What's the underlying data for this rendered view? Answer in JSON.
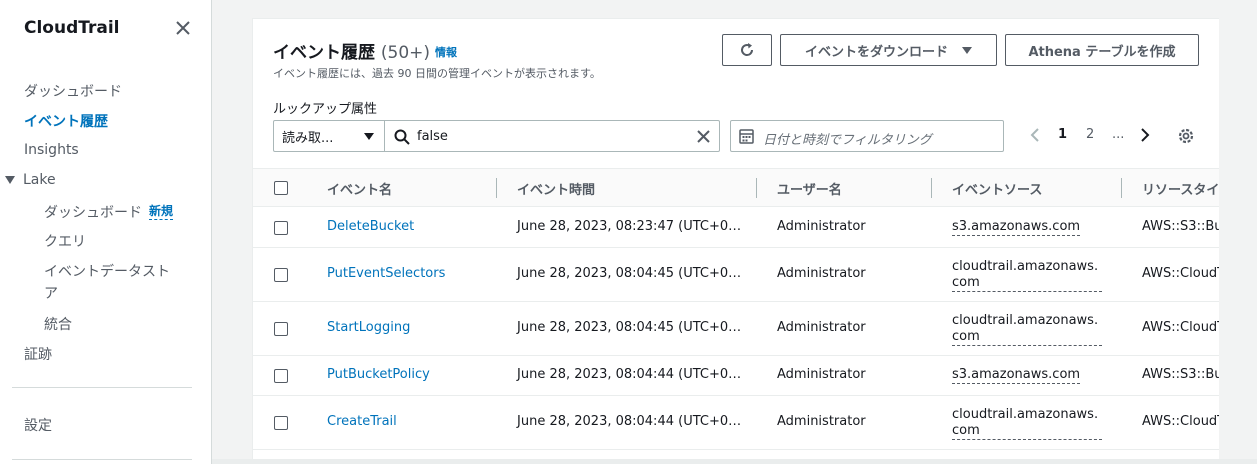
{
  "sidebar": {
    "title": "CloudTrail",
    "items": [
      {
        "label": "ダッシュボード"
      },
      {
        "label": "イベント履歴"
      },
      {
        "label": "Insights"
      },
      {
        "label": "Lake"
      },
      {
        "label": "ダッシュボード"
      },
      {
        "label": "クエリ"
      },
      {
        "label": "イベントデータスト"
      },
      {
        "label": "ア"
      },
      {
        "label": "統合"
      },
      {
        "label": "証跡"
      },
      {
        "label": "設定"
      }
    ],
    "new_badge": "新規"
  },
  "header": {
    "title": "イベント履歴",
    "count": "(50+)",
    "info": "情報",
    "description": "イベント履歴には、過去 90 日間の管理イベントが表示されます。",
    "download_label": "イベントをダウンロード",
    "athena_label": "Athena テーブルを作成"
  },
  "filter": {
    "lookup_label": "ルックアップ属性",
    "attribute_value": "読み取...",
    "search_value": "false",
    "date_placeholder": "日付と時刻でフィルタリング"
  },
  "pagination": {
    "pages": [
      "1",
      "2",
      "..."
    ],
    "current": "1"
  },
  "table": {
    "columns": [
      "イベント名",
      "イベント時間",
      "ユーザー名",
      "イベントソース",
      "リソースタイプ"
    ],
    "rows": [
      {
        "event_name": "DeleteBucket",
        "event_time": "June 28, 2023, 08:23:47 (UTC+0…",
        "user": "Administrator",
        "source": "s3.amazonaws.com",
        "resource": "AWS::S3::Bu"
      },
      {
        "event_name": "PutEventSelectors",
        "event_time": "June 28, 2023, 08:04:45 (UTC+0…",
        "user": "Administrator",
        "source": "cloudtrail.amazonaws.com",
        "resource": "AWS::CloudT"
      },
      {
        "event_name": "StartLogging",
        "event_time": "June 28, 2023, 08:04:45 (UTC+0…",
        "user": "Administrator",
        "source": "cloudtrail.amazonaws.com",
        "resource": "AWS::CloudT"
      },
      {
        "event_name": "PutBucketPolicy",
        "event_time": "June 28, 2023, 08:04:44 (UTC+0…",
        "user": "Administrator",
        "source": "s3.amazonaws.com",
        "resource": "AWS::S3::Bu"
      },
      {
        "event_name": "CreateTrail",
        "event_time": "June 28, 2023, 08:04:44 (UTC+0…",
        "user": "Administrator",
        "source": "cloudtrail.amazonaws.com",
        "resource": "AWS::CloudT"
      }
    ]
  },
  "colors": {
    "link": "#0073bb",
    "text": "#16191f",
    "muted": "#545b64",
    "border": "#aab7b8",
    "background": "#f2f3f3"
  }
}
